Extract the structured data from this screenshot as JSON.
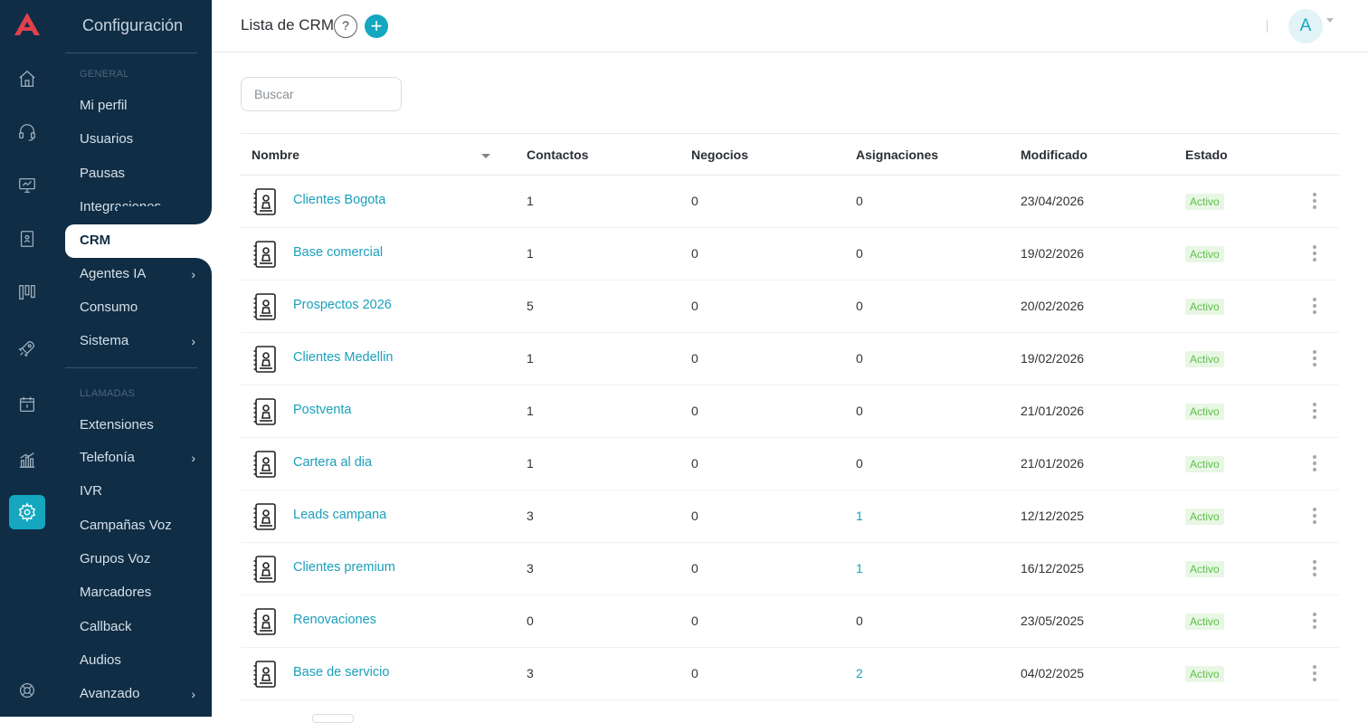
{
  "app": {
    "brand_color": "#14a7bf",
    "sidebar_color": "#0f2d45"
  },
  "rail": {
    "items": [
      {
        "name": "home-icon",
        "active": false
      },
      {
        "name": "headset-icon",
        "active": false
      },
      {
        "name": "monitor-icon",
        "active": false
      },
      {
        "name": "contacts-book-icon",
        "active": false
      },
      {
        "name": "kanban-icon",
        "active": false
      },
      {
        "name": "rocket-icon",
        "active": false
      },
      {
        "name": "calendar-icon",
        "active": false
      },
      {
        "name": "bar-chart-icon",
        "active": false
      },
      {
        "name": "gear-icon",
        "active": true
      },
      {
        "name": "lifebuoy-icon",
        "active": false
      }
    ]
  },
  "menu": {
    "title": "Configuración",
    "section_general": "GENERAL",
    "section_calls": "LLAMADAS",
    "items": [
      {
        "label": "Mi perfil",
        "has_submenu": false
      },
      {
        "label": "Usuarios",
        "has_submenu": false
      },
      {
        "label": "Pausas",
        "has_submenu": false
      },
      {
        "label": "Integraciones",
        "has_submenu": false
      },
      {
        "label": "CRM",
        "has_submenu": false,
        "active": true
      },
      {
        "label": "Agentes IA",
        "has_submenu": true
      },
      {
        "label": "Consumo",
        "has_submenu": false
      },
      {
        "label": "Sistema",
        "has_submenu": true
      },
      {
        "label": "Extensiones",
        "has_submenu": false
      },
      {
        "label": "Telefonía",
        "has_submenu": true
      },
      {
        "label": "IVR",
        "has_submenu": false
      },
      {
        "label": "Campañas Voz",
        "has_submenu": false
      },
      {
        "label": "Grupos Voz",
        "has_submenu": false
      },
      {
        "label": "Marcadores",
        "has_submenu": false
      },
      {
        "label": "Callback",
        "has_submenu": false
      },
      {
        "label": "Audios",
        "has_submenu": false
      },
      {
        "label": "Avanzado",
        "has_submenu": true
      }
    ],
    "chevron": "›"
  },
  "header": {
    "title": "Lista de CRM",
    "help_label": "?",
    "add_label": "+",
    "avatar_initial": "A"
  },
  "search": {
    "placeholder": "Buscar",
    "value": ""
  },
  "table": {
    "columns": [
      "Nombre",
      "Contactos",
      "Negocios",
      "Asignaciones",
      "Modificado",
      "Estado"
    ],
    "rows": [
      {
        "name": "Clientes Bogota",
        "contacts": "1",
        "deals": "0",
        "assignments": "0",
        "modified": "23/04/2026",
        "status": "Activo"
      },
      {
        "name": "Base comercial",
        "contacts": "1",
        "deals": "0",
        "assignments": "0",
        "modified": "19/02/2026",
        "status": "Activo"
      },
      {
        "name": "Prospectos 2026",
        "contacts": "5",
        "deals": "0",
        "assignments": "0",
        "modified": "20/02/2026",
        "status": "Activo"
      },
      {
        "name": "Clientes Medellin",
        "contacts": "1",
        "deals": "0",
        "assignments": "0",
        "modified": "19/02/2026",
        "status": "Activo"
      },
      {
        "name": "Postventa",
        "contacts": "1",
        "deals": "0",
        "assignments": "0",
        "modified": "21/01/2026",
        "status": "Activo"
      },
      {
        "name": "Cartera al dia",
        "contacts": "1",
        "deals": "0",
        "assignments": "0",
        "modified": "21/01/2026",
        "status": "Activo"
      },
      {
        "name": "Leads campana",
        "contacts": "3",
        "deals": "0",
        "assignments": "1",
        "modified": "12/12/2025",
        "status": "Activo"
      },
      {
        "name": "Clientes premium",
        "contacts": "3",
        "deals": "0",
        "assignments": "1",
        "modified": "16/12/2025",
        "status": "Activo"
      },
      {
        "name": "Renovaciones",
        "contacts": "0",
        "deals": "0",
        "assignments": "0",
        "modified": "23/05/2025",
        "status": "Activo"
      },
      {
        "name": "Base de servicio",
        "contacts": "3",
        "deals": "0",
        "assignments": "2",
        "modified": "04/02/2025",
        "status": "Activo"
      }
    ]
  }
}
